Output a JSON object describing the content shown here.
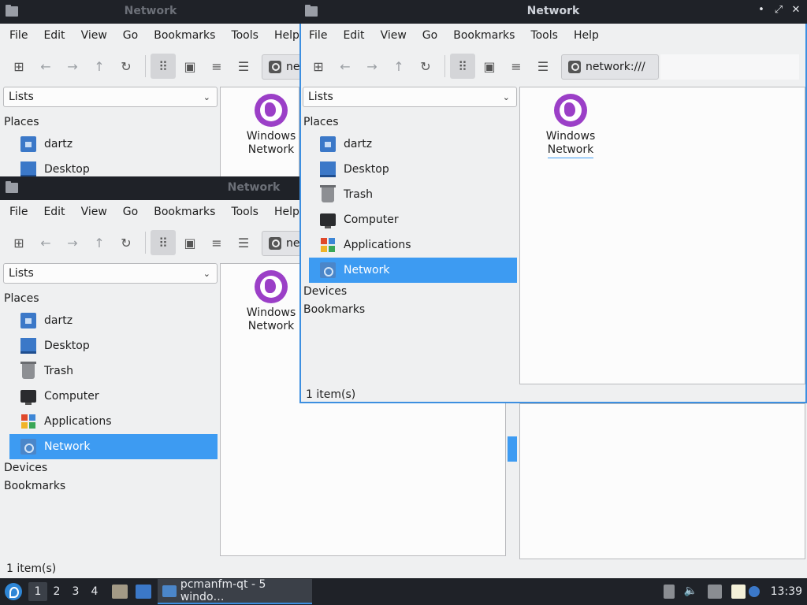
{
  "window": {
    "title": "Network",
    "controls": {
      "minimize": "•",
      "maximize": "⤢",
      "close": "✕"
    }
  },
  "menu": [
    "File",
    "Edit",
    "View",
    "Go",
    "Bookmarks",
    "Tools",
    "Help"
  ],
  "menu_truncated_help": "Help",
  "toolbar": {
    "icons": [
      "new-tab-icon",
      "back-arrow-icon",
      "forward-arrow-icon",
      "up-arrow-icon",
      "reload-icon",
      "icon-view-icon",
      "thumbnail-view-icon",
      "compact-view-icon",
      "detailed-list-icon"
    ],
    "glyphs": {
      "newtab": "⊞",
      "back": "←",
      "forward": "→",
      "up": "↑",
      "reload": "↻",
      "iconview": "⠿",
      "thumb": "▣",
      "compact": "≡",
      "list": "☰"
    }
  },
  "path": {
    "full": "network:///",
    "truncated": "ne"
  },
  "sidebar": {
    "combo": "Lists",
    "combo_arrow": "⌄",
    "places_header": "Places",
    "places": [
      {
        "label": "dartz",
        "icon": "home-folder-icon"
      },
      {
        "label": "Desktop",
        "icon": "desktop-icon"
      },
      {
        "label": "Trash",
        "icon": "trash-icon"
      },
      {
        "label": "Computer",
        "icon": "computer-icon"
      },
      {
        "label": "Applications",
        "icon": "applications-icon"
      },
      {
        "label": "Network",
        "icon": "network-icon"
      }
    ],
    "devices_header": "Devices",
    "bookmarks_header": "Bookmarks"
  },
  "files": [
    {
      "line1": "Windows",
      "line2": "Network",
      "icon": "windows-network-globe-icon"
    }
  ],
  "status": "1 item(s)",
  "taskbar": {
    "desktops": [
      "1",
      "2",
      "3",
      "4"
    ],
    "current_desktop": "1",
    "task_label": "pcmanfm-qt - 5 windo…",
    "clock": "13:39",
    "colors": {
      "accent": "#3d8fe0",
      "selection": "#3d9bf2",
      "globe": "#9b3fc7"
    }
  }
}
